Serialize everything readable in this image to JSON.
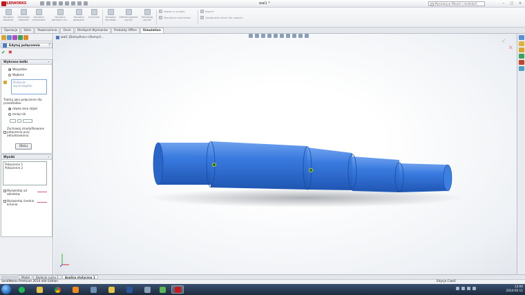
{
  "window": {
    "app_name": "SOLIDWORKS",
    "doc_title": "wal1 *",
    "search_placeholder": "Wyszukaj w Plikach i modelach",
    "min": "–",
    "max": "□",
    "close": "×"
  },
  "ribbon": {
    "buttons": [
      "Doradca badania",
      "Zachowaj materiał",
      "Doradca umocowań",
      "Doradca obciążeń ze...",
      "Doradca połączeń",
      "Uruchom",
      "Doradca wyników",
      "Zdeformowane wyniki",
      "Porównaj wyniki"
    ],
    "small_items": [
      "Wgląd w projekt",
      "Narzędzia wykresów",
      "Raport",
      "Uwzględnij obraz dla raportu"
    ]
  },
  "command_tabs": [
    "Operacje",
    "Szkic",
    "Powierzchnia",
    "Oceń",
    "DimXpert Wymiarów",
    "Produkty Office",
    "Simulation"
  ],
  "command_tab_active": "Simulation",
  "property_manager": {
    "title": "Edytuj połączenia",
    "help": "?",
    "ok": "✔",
    "cancel": "✖",
    "group1": {
      "header": "Wybrane bełki",
      "opt_all": "Wszystkie",
      "opt_selected": "Wybierz",
      "list_text": "Dodanie-wyszczególni",
      "treat_label": "Traktuj jako połączenie dla przedziałów:",
      "opt_clearance": "równe zero (styk)",
      "opt_less": "mniej niż",
      "keep_label": "Zachowaj zmodyfikowane połączenia przy aktualizowaniu",
      "compute_button": "Oblicz"
    },
    "group2": {
      "header": "Wyniki",
      "items": [
        "Połączenie 1",
        "Połączenie 2"
      ],
      "show_joints": "Wyświetlaj od obiektów",
      "show_diam": "Wyświetlaj średnie kmania"
    }
  },
  "viewport": {
    "breadcrumb": "wal1 (Domyślna<<Domyśl..."
  },
  "bottom_tabs": [
    "Model",
    "Badanie ruchu 1",
    "Analiza statyczna 1"
  ],
  "bottom_tab_active": "Analiza statyczna 1",
  "status": {
    "left": "SolidWorks Premium 2014 x64 Edition",
    "right": "Edycja Część"
  },
  "taskbar": {
    "time": "12:00",
    "date": "2014-05-11"
  },
  "colors": {
    "shaft": "#2f6fd6",
    "accent": "#c8161d"
  }
}
